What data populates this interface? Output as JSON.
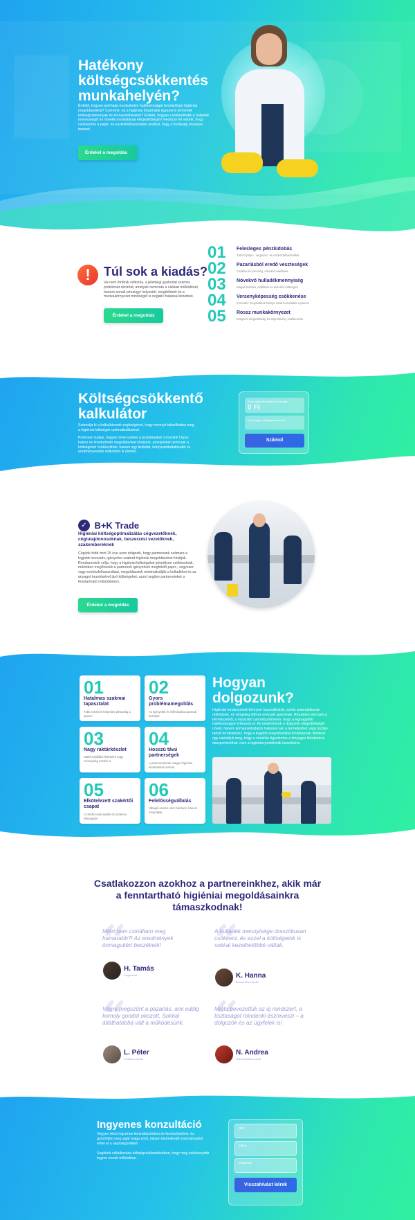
{
  "hero": {
    "title_line1": "Hatékony",
    "title_line2": "költségcsökkentés",
    "title_line3": "munkahelyén?",
    "body": "Érdekli, hogyan javíthatja munkahelye hatékonyságát fenntartható higiéniai megoldásokkal? Szeretné, ha a higiéniai folyamatai egyszerre lennének költséghatékonyak és környezetbarátok? Érdekli, hogyan csökkenthetik a hulladék mennyiségét és növelik munkatársai elégedettségét? Fedezze fel velünk, hogy csökkentse a papír- és eszközfelhasználást anélkül, hogy a tisztaság rovására menne!",
    "button": "Érdekel a megoldás"
  },
  "problem": {
    "icon": "exclamation-icon",
    "title": "Túl sok a kiadás?",
    "body": "Ha nem történik változás, a jelenlegi gyakorlat számos problémát okozhat, amelyek nemcsak a vállalat működését, hanem annak pénzügyi helyzetét, megítélését és a munkakörnyezet minőségét is negatív hatással lehetnek.",
    "button": "Érdekel a megoldás",
    "items": [
      {
        "num": "01",
        "title": "Felesleges pénzkidobás",
        "desc": "Túlzott papír-, vegyszer- és eszközfelhasználás"
      },
      {
        "num": "02",
        "title": "Pazarlásból eredő veszteségek",
        "desc": "Csökkenő nyereség, növekvő kiadások"
      },
      {
        "num": "03",
        "title": "Növekvő hulladékmennyiség",
        "desc": "Magas tárolási, szállítási és kezelési költségek"
      },
      {
        "num": "04",
        "title": "Versenyképesség csökkenése",
        "desc": "Innovatív megoldások hiánya miatt lemaradás a piacon"
      },
      {
        "num": "05",
        "title": "Rossz munkakörnyezet",
        "desc": "Dolgozói elégedettség és teljesítmény csökkenése"
      }
    ]
  },
  "calculator": {
    "title_line1": "Költségcsökkentő",
    "title_line2": "kalkulátor",
    "body1": "Számolja ki a kalkulátorunk segítségével, hogy mennyit takaríthatna meg a higiéniai költségek optimalizálásával.",
    "body2": "Pontosan tudjuk, hogyan lehet ezeket a problémákat orvosolni! Olyan habos és fenntartható megoldásokat kínálunk, amelyekkel nemcsak a költségeket csökkentheti, hanem egy tisztább, környezettudatosabb és eredményesebb működést is elérhet.",
    "field1_label": "Éves higiéniai kiadások összege",
    "field1_value": "0 Ft",
    "field2_label": "Lehetséges költségcsökkentés",
    "button": "Számol"
  },
  "about": {
    "logo_text": "B+K Trade",
    "subtitle": "Higiéniai költségoptimalizálás cégvezetőknek, cégtulajdonosoknak, beszerzési vezetőknek, szakembereknek",
    "body": "Cégünk több mint 25 éve azon dolgozik, hogy partnereink számára a legjobb innovatív, igényekre szabott higiéniai megoldásokat kínáljuk. Rendszereink célja, hogy a higiéniai költségeket jelentősen csökkentsük, miközben megőrizzük a partnerek igényeinek megfelelő papír-, vegyszer- vagy eszközfelhasználást, megoldásaink minimalizálják a hulladékot és az anyagot kezelésével járó költségeket, ezzel segítve partnereinket a fenntartható működésben.",
    "button": "Érdekel a megoldás"
  },
  "how": {
    "title_line1": "Hogyan",
    "title_line2": "dolgozunk?",
    "body": "Higiéniai rendszereink könnyen használhatók, szinte automatikusan működnek, és rengeteg időt és energiát spórolnak. Részletes elemzés a bérhelyzetről, a használó szemelyzetmérés, hogy a legnagyobb hatékonyságot érhessük el. Az eredmények a dolgozók elégedettségét növeli, hanem környezettudatos hatással van a termeléshez vagy tisztán tartott területekhez, hogy a legjobb megoldásokat kínálhassuk. Mindezt úgy valósítjuk meg, hogy a vásárlás figyelembe a lényeges feladatokra összpontosíthat, nem a higiéniai problémák kezelésére.",
    "cards": [
      {
        "num": "01",
        "title": "Hatalmas szakmai tapasztalat",
        "desc": "Több mint két évtizedes jártasság a piacon"
      },
      {
        "num": "02",
        "title": "Gyors problémamegoldás",
        "desc": "Az igényeket és kihívásokat azonnal kezeljük"
      },
      {
        "num": "03",
        "title": "Nagy raktárkészlet",
        "desc": "Stabil szállítási feltételek nagy mennyiség esetén is"
      },
      {
        "num": "04",
        "title": "Hosszú távú partnerségek",
        "desc": "A partnereinknek magas higiéniai elvárásokat vannak"
      },
      {
        "num": "05",
        "title": "Elkötelezett szakértői csapat",
        "desc": "A cinkás tanácsadás és szakmai támogatás"
      },
      {
        "num": "06",
        "title": "Felelősségvállalás",
        "desc": "Hibájuk esetén nem hárítunk, hanem megoldjuk"
      }
    ]
  },
  "testimonials": {
    "heading": "Csatlakozzon azokhoz a partnereinkhez, akik már a fenntartható higiéniai megoldásainkra támaszkodnak!",
    "items": [
      {
        "quote": "Miért nem csináltam meg hamarabb?! Az eredmények önmagukért beszélnek!",
        "name": "H. Tamás",
        "role": "Cégvezető"
      },
      {
        "quote": "A hulladék mennyisége drasztikusan csökkent, és ezzel a költségeink is sokkal kezelhetőbbé váltak.",
        "name": "K. Hanna",
        "role": "Beszerzési vezető"
      },
      {
        "quote": "Végre megszűnt a pazarlás, ami eddig komoly gondot okozott. Sokkal átláthatóbbá vált a működésünk.",
        "name": "L. Péter",
        "role": "Irodaház kezelő"
      },
      {
        "quote": "Mióta bevezettük az új rendszert, a tisztaságot mindenki észreveszi – a dolgozók és az ügyfelek is!",
        "name": "N. Andrea",
        "role": "Üzemeltetési vezető"
      }
    ]
  },
  "consult": {
    "title": "Ingyenes konzultáció",
    "body1": "Vegyen részt ingyenes konzultációnkon és fenntarthatónk, és győződjön meg saját maga arról, milyen kiemelkedő eredményeket érhet el a segítségünkkel!",
    "body2": "Segítünk vállalkozása költségcsökkentésében, hogy meg hatékonyabb legyen annak működése.",
    "field_name": "NÉV",
    "field_email": "EMAIL",
    "field_phone": "TELEFON",
    "button": "Visszahívást kérek"
  },
  "colors": {
    "navy": "#2d2a7a",
    "teal": "#22c9b6",
    "green": "#2bd98f",
    "blue": "#1fa3f0"
  }
}
